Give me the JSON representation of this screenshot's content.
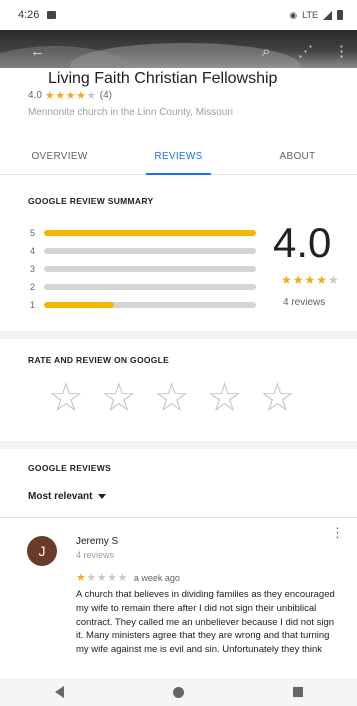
{
  "status_bar": {
    "time": "4:26",
    "network": "LTE"
  },
  "place": {
    "name": "Living Faith Christian Fellowship",
    "rating": "4.0",
    "stars_filled": "★★★★",
    "stars_empty": "★",
    "review_count": "(4)",
    "category": "Mennonite church in the Linn County, Missouri"
  },
  "tabs": [
    {
      "label": "OVERVIEW",
      "active": false
    },
    {
      "label": "REVIEWS",
      "active": true
    },
    {
      "label": "ABOUT",
      "active": false
    }
  ],
  "summary": {
    "title": "GOOGLE REVIEW SUMMARY",
    "average": "4.0",
    "stars_filled": "★★★★",
    "stars_empty": "★",
    "reviews_label": "4 reviews",
    "distribution": [
      {
        "label": "5",
        "fraction": 1.0
      },
      {
        "label": "4",
        "fraction": 0.0
      },
      {
        "label": "3",
        "fraction": 0.0
      },
      {
        "label": "2",
        "fraction": 0.0
      },
      {
        "label": "1",
        "fraction": 0.33
      }
    ]
  },
  "rate": {
    "title": "RATE AND REVIEW ON GOOGLE",
    "star_glyph": "☆"
  },
  "google_reviews": {
    "title": "GOOGLE REVIEWS",
    "sort_label": "Most relevant"
  },
  "review": {
    "avatar_letter": "J",
    "author": "Jeremy S",
    "author_meta": "4 reviews",
    "stars_filled": "★",
    "stars_empty": "★★★★",
    "date": "a week ago",
    "text": "A church that believes in dividing families as they encouraged my wife to remain there after I did not sign their unbiblical contract. They called me an unbeliever because I did not sign it. Many ministers agree that they are wrong and that turning my wife against me is evil and sin. Unfortunately they think"
  },
  "icons": {
    "back": "←",
    "search": "⌕",
    "share": "⋰",
    "more": "⋮"
  },
  "colors": {
    "accent": "#1a73e8",
    "star": "#f4a820",
    "avatar": "#6b3a2a"
  }
}
